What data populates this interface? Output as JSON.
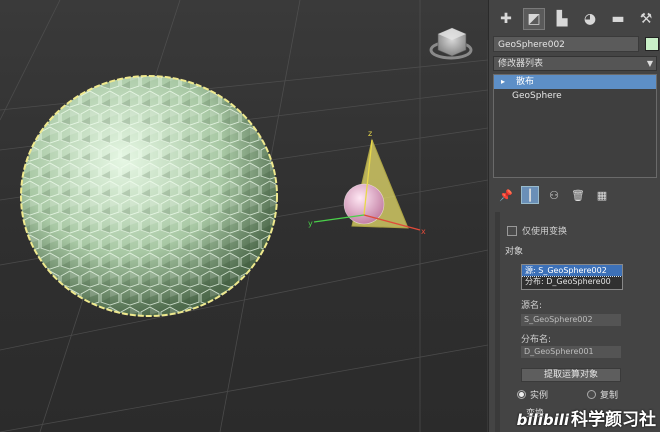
{
  "colors": {
    "selection_blue": "#5d8fc7",
    "object_color": "#c9f0c8",
    "selection_outline": "#e8e08a",
    "axis_x": "#e04a3a",
    "axis_y": "#4ad04a",
    "axis_z": "#e8d84a"
  },
  "toolbar": {
    "icons": [
      "create-icon",
      "modify-icon",
      "hierarchy-icon",
      "motion-icon",
      "display-icon",
      "utilities-icon"
    ]
  },
  "object": {
    "name": "GeoSphere002"
  },
  "modifier_list": {
    "label": "修改器列表"
  },
  "stack": {
    "items": [
      {
        "label": "散布",
        "selected": true
      },
      {
        "label": "GeoSphere",
        "selected": false
      }
    ]
  },
  "scatter": {
    "partial_label": "仅使用变换",
    "objects_group_label": "对象",
    "object_list": [
      {
        "label": "源: S_GeoSphere002",
        "selected": true
      },
      {
        "label": "分布: D_GeoSphere00",
        "selected": false
      }
    ],
    "source_name_label": "源名:",
    "source_name_value": "S_GeoSphere002",
    "distribution_name_label": "分布名:",
    "distribution_name_value": "D_GeoSphere001",
    "extract_button": "提取运算对象",
    "radio_instance": "实例",
    "radio_copy": "复制",
    "bottom_partial": "变换"
  },
  "viewport": {
    "axis_x": "x",
    "axis_y": "y",
    "axis_z": "z"
  },
  "watermark": {
    "brand": "bilibili",
    "text": "科学颜习社"
  }
}
